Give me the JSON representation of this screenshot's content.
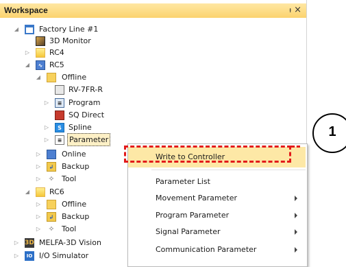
{
  "window": {
    "title": "Workspace",
    "pin_glyph": "ᵼ",
    "close_glyph": "×"
  },
  "tree": {
    "items": [
      {
        "label": "Factory Line #1",
        "expanded": true,
        "icon": "window-icon"
      },
      {
        "label": "3D Monitor",
        "icon": "monitor-icon"
      },
      {
        "label": "RC4",
        "expanded": false,
        "icon": "controller-icon"
      },
      {
        "label": "RC5",
        "expanded": true,
        "icon": "controller-online-icon"
      },
      {
        "label": "Offline",
        "expanded": true,
        "icon": "folder-icon"
      },
      {
        "label": "RV-7FR-R",
        "icon": "robot-icon"
      },
      {
        "label": "Program",
        "expanded": false,
        "icon": "program-icon"
      },
      {
        "label": "SQ Direct",
        "icon": "sq-direct-icon"
      },
      {
        "label": "Spline",
        "expanded": false,
        "icon": "spline-icon"
      },
      {
        "label": "Parameter",
        "expanded": false,
        "selected": true,
        "icon": "parameter-icon"
      },
      {
        "label": "Online",
        "expanded": false,
        "icon": "online-icon"
      },
      {
        "label": "Backup",
        "expanded": false,
        "icon": "backup-icon"
      },
      {
        "label": "Tool",
        "expanded": false,
        "icon": "tool-icon"
      },
      {
        "label": "RC6",
        "expanded": true,
        "icon": "controller-icon"
      },
      {
        "label": "Offline",
        "expanded": false,
        "icon": "folder-icon"
      },
      {
        "label": "Backup",
        "expanded": false,
        "icon": "backup-icon"
      },
      {
        "label": "Tool",
        "expanded": false,
        "icon": "tool-icon"
      },
      {
        "label": "MELFA-3D Vision",
        "expanded": false,
        "icon": "vision-3d-icon"
      },
      {
        "label": "I/O Simulator",
        "expanded": false,
        "icon": "io-simulator-icon"
      }
    ]
  },
  "context_menu": {
    "items": [
      {
        "label": "Write to Controller",
        "highlighted": true,
        "submenu": false
      },
      {
        "label": "Parameter List",
        "submenu": false
      },
      {
        "label": "Movement Parameter",
        "submenu": true
      },
      {
        "label": "Program Parameter",
        "submenu": true
      },
      {
        "label": "Signal Parameter",
        "submenu": true
      },
      {
        "label": "Communication Parameter",
        "submenu": true
      }
    ]
  },
  "callout": {
    "number": "1",
    "color": "#e21b1b"
  },
  "colors": {
    "header_bg": "#fbd36e",
    "menu_highlight": "#fde8a6",
    "selection_bg": "#fdf0c6"
  }
}
